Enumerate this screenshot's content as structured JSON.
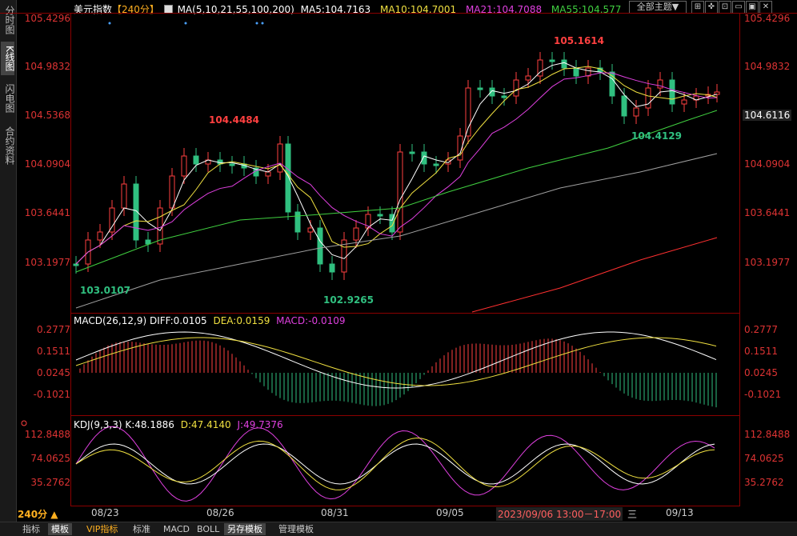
{
  "left_tabs": [
    "分时图",
    "K线图",
    "闪电图",
    "合约资料"
  ],
  "top_right": {
    "theme_label": "全部主题▼"
  },
  "main_header": {
    "name": "美元指数",
    "period": "【240分】",
    "ma_params": "MA(5,10,21,55,100,200)",
    "ma5": "MA5:104.7163",
    "ma10": "MA10:104.7001",
    "ma21": "MA21:104.7088",
    "ma55": "MA55:104.577"
  },
  "price_axis": [
    "105.4296",
    "104.9832",
    "104.5368",
    "104.0904",
    "103.6441",
    "103.1977"
  ],
  "right_price_axis_extra": "104.6116",
  "annotations": {
    "high1": "105.1614",
    "high2": "104.4484",
    "low1": "103.0107",
    "low2": "102.9265",
    "low3": "104.4129"
  },
  "macd_header": {
    "label": "MACD(26,12,9)",
    "diff": "DIFF:0.0105",
    "dea": "DEA:0.0159",
    "macd": "MACD:-0.0109"
  },
  "macd_axis": [
    "0.2777",
    "0.1511",
    "0.0245",
    "-0.1021"
  ],
  "kdj_header": {
    "label": "KDJ(9,3,3)",
    "k": "K:48.1886",
    "d": "D:47.4140",
    "j": "J:49.7376"
  },
  "kdj_axis": [
    "112.8488",
    "74.0625",
    "35.2762"
  ],
  "period_label": "240分 ▲",
  "date_labels": [
    "08/23",
    "08/26",
    "08/31",
    "09/05",
    "09/13"
  ],
  "cursor_time": "2023/09/06 13:00－17:00",
  "cursor_icon": "三",
  "bottom_tabs": [
    "指标",
    "模板",
    "VIP指标",
    "标准",
    "MACD",
    "BOLL",
    "另存模板",
    "管理模板"
  ],
  "colors": {
    "up": "#ff4040",
    "down": "#30c080",
    "ma5": "#ffffff",
    "ma10": "#f0e040",
    "ma21": "#e040e0",
    "ma55": "#40d040",
    "ma100": "#a0a0a0",
    "ma200": "#ff3030"
  }
}
